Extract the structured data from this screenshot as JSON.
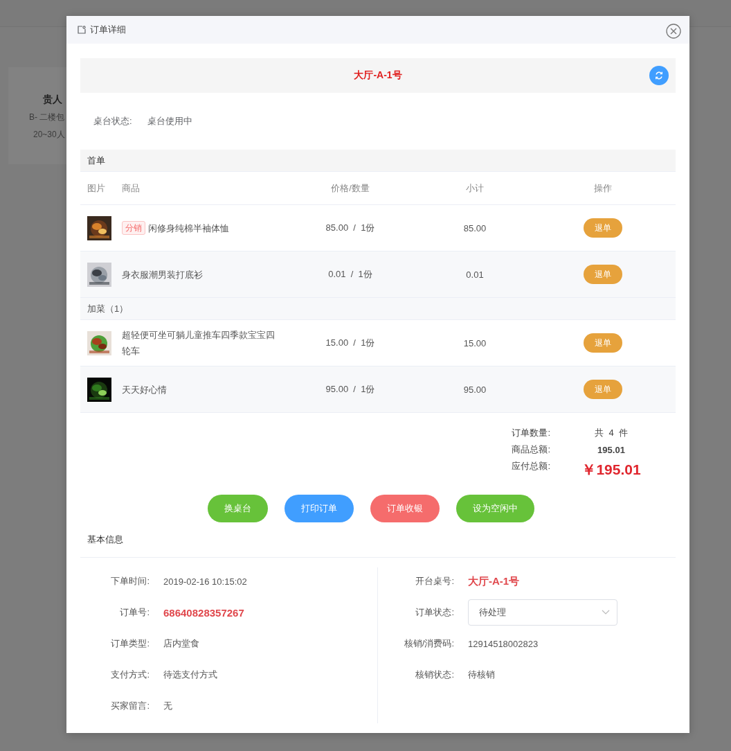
{
  "background_card": {
    "title": "贵人",
    "lines": [
      "B- 二楼包",
      "20~30人"
    ]
  },
  "dialog": {
    "title": "订单详细"
  },
  "table_banner": {
    "name": "大厅-A-1号"
  },
  "table_status": {
    "label": "桌台状态:",
    "value": "桌台使用中"
  },
  "first_order": {
    "title": "首单",
    "columns": [
      "图片",
      "商品",
      "价格/数量",
      "小计",
      "操作"
    ],
    "rows": [
      {
        "tag": "分销",
        "name": "闲修身纯棉半袖体恤",
        "price_qty": "85.00  /  1份",
        "subtotal": "85.00",
        "action": "退单"
      },
      {
        "name": "身衣服潮男装打底衫",
        "price_qty": "0.01  /  1份",
        "subtotal": "0.01",
        "action": "退单"
      }
    ]
  },
  "added_order": {
    "title": "加菜（1）",
    "rows": [
      {
        "name": "超轻便可坐可躺儿童推车四季款宝宝四轮车",
        "price_qty": "15.00  /  1份",
        "subtotal": "15.00",
        "action": "退单"
      },
      {
        "name": "天天好心情",
        "price_qty": "95.00  /  1份",
        "subtotal": "95.00",
        "action": "退单"
      }
    ]
  },
  "summary": [
    {
      "label": "订单数量:",
      "value": "共  4  件",
      "kind": "plain"
    },
    {
      "label": "商品总额:",
      "value": "195.01",
      "kind": "bold"
    },
    {
      "label": "应付总额:",
      "value": "￥195.01",
      "kind": "total"
    }
  ],
  "actions": [
    {
      "label": "换桌台",
      "color": "#67c23a"
    },
    {
      "label": "打印订单",
      "color": "#409eff"
    },
    {
      "label": "订单收银",
      "color": "#f56c6c"
    },
    {
      "label": "设为空闲中",
      "color": "#67c23a"
    }
  ],
  "basic_info": {
    "title": "基本信息",
    "left": [
      {
        "label": "下单时间:",
        "value": "2019-02-16 10:15:02",
        "kind": "text"
      },
      {
        "label": "订单号:",
        "value": "68640828357267",
        "kind": "highlight"
      },
      {
        "label": "订单类型:",
        "value": "店内堂食",
        "kind": "text"
      },
      {
        "label": "支付方式:",
        "value": "待选支付方式",
        "kind": "text"
      },
      {
        "label": "买家留言:",
        "value": "无",
        "kind": "text"
      }
    ],
    "right": [
      {
        "label": "开台桌号:",
        "value": "大厅-A-1号",
        "kind": "highlight"
      },
      {
        "label": "订单状态:",
        "value": "待处理",
        "kind": "select"
      },
      {
        "label": "核销/消费码:",
        "value": "12914518002823",
        "kind": "text"
      },
      {
        "label": "核销状态:",
        "value": "待核销",
        "kind": "text"
      }
    ]
  }
}
